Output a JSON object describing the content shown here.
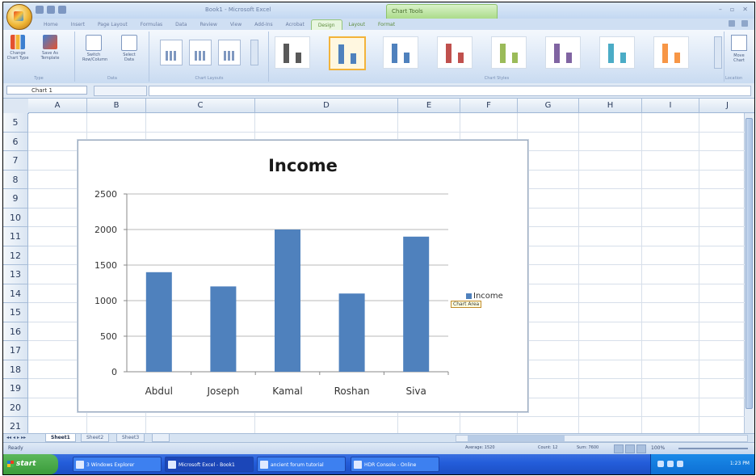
{
  "title_bar": {
    "window_title": "Book1 - Microsoft Excel",
    "context_tab_group": "Chart Tools"
  },
  "ribbon": {
    "tabs": [
      "Home",
      "Insert",
      "Page Layout",
      "Formulas",
      "Data",
      "Review",
      "View",
      "Add-Ins",
      "Acrobat",
      "Design",
      "Layout",
      "Format"
    ],
    "active_tab": "Design",
    "groups": {
      "type": {
        "label": "Type",
        "buttons": [
          "Change Chart Type",
          "Save As Template"
        ]
      },
      "data": {
        "label": "Data",
        "buttons": [
          "Switch Row/Column",
          "Select Data"
        ]
      },
      "layouts": {
        "label": "Chart Layouts"
      },
      "styles": {
        "label": "Chart Styles"
      },
      "location": {
        "label": "Location",
        "buttons": [
          "Move Chart"
        ]
      }
    },
    "chart_styles": [
      {
        "colors": [
          "#595959",
          "#595959"
        ],
        "selected": false
      },
      {
        "colors": [
          "#4f81bd",
          "#4f81bd"
        ],
        "selected": true
      },
      {
        "colors": [
          "#4f81bd",
          "#4f81bd"
        ],
        "selected": false
      },
      {
        "colors": [
          "#c0504d",
          "#c0504d"
        ],
        "selected": false
      },
      {
        "colors": [
          "#9bbb59",
          "#9bbb59"
        ],
        "selected": false
      },
      {
        "colors": [
          "#8064a2",
          "#8064a2"
        ],
        "selected": false
      },
      {
        "colors": [
          "#4bacc6",
          "#4bacc6"
        ],
        "selected": false
      },
      {
        "colors": [
          "#f79646",
          "#f79646"
        ],
        "selected": false
      }
    ]
  },
  "formula_bar": {
    "name_box": "Chart 1"
  },
  "sheet": {
    "columns": [
      "A",
      "B",
      "C",
      "D",
      "E",
      "F",
      "G",
      "H",
      "I",
      "J"
    ],
    "rows": [
      "5",
      "6",
      "7",
      "8",
      "9",
      "10",
      "11",
      "12",
      "13",
      "14",
      "15",
      "16",
      "17",
      "18",
      "19",
      "20",
      "21"
    ]
  },
  "chart_data": {
    "type": "bar",
    "title": "Income",
    "categories": [
      "Abdul",
      "Joseph",
      "Kamal",
      "Roshan",
      "Siva"
    ],
    "series": [
      {
        "name": "Income",
        "values": [
          1400,
          1200,
          2000,
          1100,
          1900
        ],
        "color": "#4f81bd"
      }
    ],
    "y_ticks": [
      "0",
      "500",
      "1000",
      "1500",
      "2000",
      "2500"
    ],
    "ylim": [
      0,
      2500
    ],
    "grid": true,
    "legend_position": "right"
  },
  "chart_tooltip": "Chart Area",
  "sheet_tabs": [
    "Sheet1",
    "Sheet2",
    "Sheet3"
  ],
  "active_sheet": "Sheet1",
  "status_bar": {
    "mode": "Ready",
    "average": "Average: 1520",
    "count": "Count: 12",
    "sum": "Sum: 7600",
    "zoom": "100%"
  },
  "taskbar": {
    "start_label": "start",
    "tasks": [
      "3 Windows Explorer",
      "Microsoft Excel - Book1",
      "ancient forum tutorial",
      "HDR Console - Online"
    ],
    "active_task_index": 1,
    "clock": "1:23 PM"
  }
}
